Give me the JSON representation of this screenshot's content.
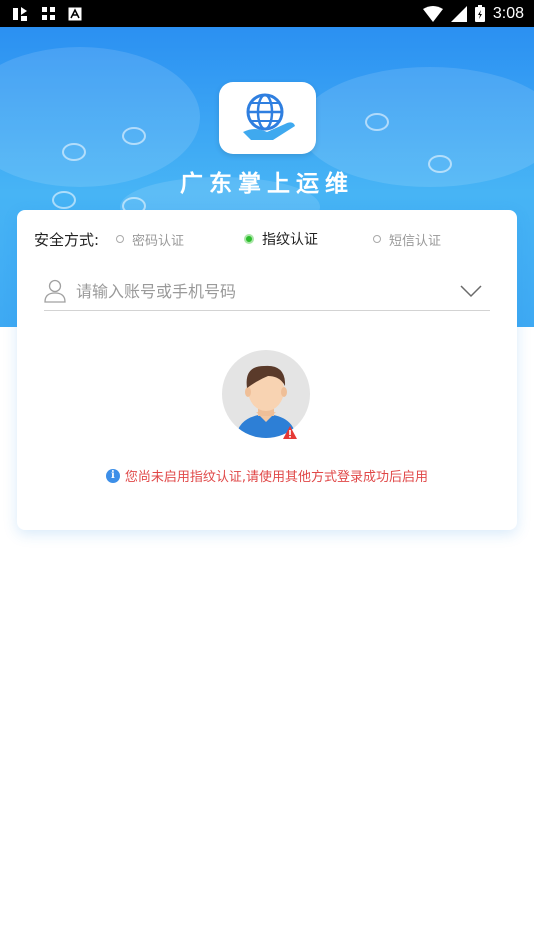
{
  "status_bar": {
    "time": "3:08",
    "left_icons": [
      "notification-icon",
      "grid-icon",
      "a-square-icon"
    ],
    "right_icons": [
      "wifi-icon",
      "signal-icon",
      "battery-icon"
    ]
  },
  "header": {
    "app_title": "广东掌上运维",
    "logo_icon": "globe-hand-icon"
  },
  "login_card": {
    "auth_label": "安全方式:",
    "auth_options": [
      {
        "label": "密码认证",
        "selected": false
      },
      {
        "label": "指纹认证",
        "selected": true
      },
      {
        "label": "短信认证",
        "selected": false
      }
    ],
    "account_placeholder": "请输入账号或手机号码",
    "notice": "您尚未启用指纹认证,请使用其他方式登录成功后启用"
  },
  "colors": {
    "header_blue": "#2b90f2",
    "notice_red": "#e04848",
    "selected_green": "#2dbd2d",
    "info_blue": "#3d8fe8"
  }
}
